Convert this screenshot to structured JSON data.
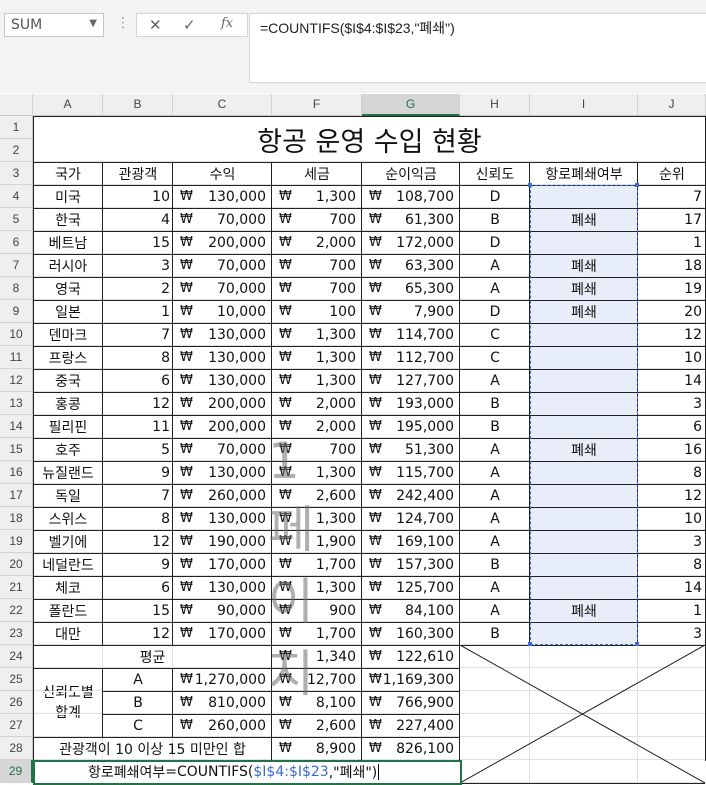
{
  "formula_bar": {
    "name_box": "SUM",
    "cancel_icon": "✕",
    "enter_icon": "✓",
    "fx_label": "fx",
    "formula": "=COUNTIFS($I$4:$I$23,\"폐쇄\")"
  },
  "columns": [
    "A",
    "B",
    "C",
    "F",
    "G",
    "H",
    "I",
    "J"
  ],
  "rows": [
    "1",
    "2",
    "3",
    "4",
    "5",
    "6",
    "7",
    "8",
    "9",
    "10",
    "11",
    "12",
    "13",
    "14",
    "15",
    "16",
    "17",
    "18",
    "19",
    "20",
    "21",
    "22",
    "23",
    "24",
    "25",
    "26",
    "27",
    "28",
    "29"
  ],
  "sheet": {
    "title": "항공 운영 수입 현황",
    "headers": [
      "국가",
      "관광객",
      "수익",
      "세금",
      "순이익금",
      "신뢰도",
      "항로폐쇄여부",
      "순위"
    ],
    "currency": "₩",
    "data_rows": [
      [
        "미국",
        "10",
        "130,000",
        "1,300",
        "108,700",
        "D",
        "",
        "7"
      ],
      [
        "한국",
        "4",
        "70,000",
        "700",
        "61,300",
        "B",
        "폐쇄",
        "17"
      ],
      [
        "베트남",
        "15",
        "200,000",
        "2,000",
        "172,000",
        "D",
        "",
        "1"
      ],
      [
        "러시아",
        "3",
        "70,000",
        "700",
        "63,300",
        "A",
        "폐쇄",
        "18"
      ],
      [
        "영국",
        "2",
        "70,000",
        "700",
        "65,300",
        "A",
        "폐쇄",
        "19"
      ],
      [
        "일본",
        "1",
        "10,000",
        "100",
        "7,900",
        "D",
        "폐쇄",
        "20"
      ],
      [
        "덴마크",
        "7",
        "130,000",
        "1,300",
        "114,700",
        "C",
        "",
        "12"
      ],
      [
        "프랑스",
        "8",
        "130,000",
        "1,300",
        "112,700",
        "C",
        "",
        "10"
      ],
      [
        "중국",
        "6",
        "130,000",
        "1,300",
        "127,700",
        "A",
        "",
        "14"
      ],
      [
        "홍콩",
        "12",
        "200,000",
        "2,000",
        "193,000",
        "B",
        "",
        "3"
      ],
      [
        "필리핀",
        "11",
        "200,000",
        "2,000",
        "195,000",
        "B",
        "",
        "6"
      ],
      [
        "호주",
        "5",
        "70,000",
        "700",
        "51,300",
        "A",
        "폐쇄",
        "16"
      ],
      [
        "뉴질랜드",
        "9",
        "130,000",
        "1,300",
        "115,700",
        "A",
        "",
        "8"
      ],
      [
        "독일",
        "7",
        "260,000",
        "2,600",
        "242,400",
        "A",
        "",
        "12"
      ],
      [
        "스위스",
        "8",
        "130,000",
        "1,300",
        "124,700",
        "A",
        "",
        "10"
      ],
      [
        "벨기에",
        "12",
        "190,000",
        "1,900",
        "169,100",
        "A",
        "",
        "3"
      ],
      [
        "네덜란드",
        "9",
        "170,000",
        "1,700",
        "157,300",
        "B",
        "",
        "8"
      ],
      [
        "체코",
        "6",
        "130,000",
        "1,300",
        "125,700",
        "A",
        "",
        "14"
      ],
      [
        "폴란드",
        "15",
        "90,000",
        "900",
        "84,100",
        "A",
        "폐쇄",
        "1"
      ],
      [
        "대만",
        "12",
        "170,000",
        "1,700",
        "160,300",
        "B",
        "",
        "3"
      ]
    ],
    "average": {
      "label": "평균",
      "tax": "1,340",
      "net": "122,610"
    },
    "trust_sum": {
      "label_line1": "신뢰도별",
      "label_line2": "합계",
      "rows": [
        {
          "grade": "A",
          "revenue": "1,270,000",
          "tax": "12,700",
          "net": "1,169,300"
        },
        {
          "grade": "B",
          "revenue": "810,000",
          "tax": "8,100",
          "net": "766,900"
        },
        {
          "grade": "C",
          "revenue": "260,000",
          "tax": "2,600",
          "net": "227,400"
        }
      ]
    },
    "tourist_sum": {
      "label": "관광객이 10 이상 15 미만인 합",
      "tax": "8,900",
      "net": "826,100"
    },
    "row29": {
      "label": "항로폐쇄여부",
      "formula_pre": "=COUNTIFS(",
      "formula_ref": "$I$4:$I$23",
      "formula_post": ",\"폐쇄\")"
    },
    "watermark": "1 페이지"
  }
}
